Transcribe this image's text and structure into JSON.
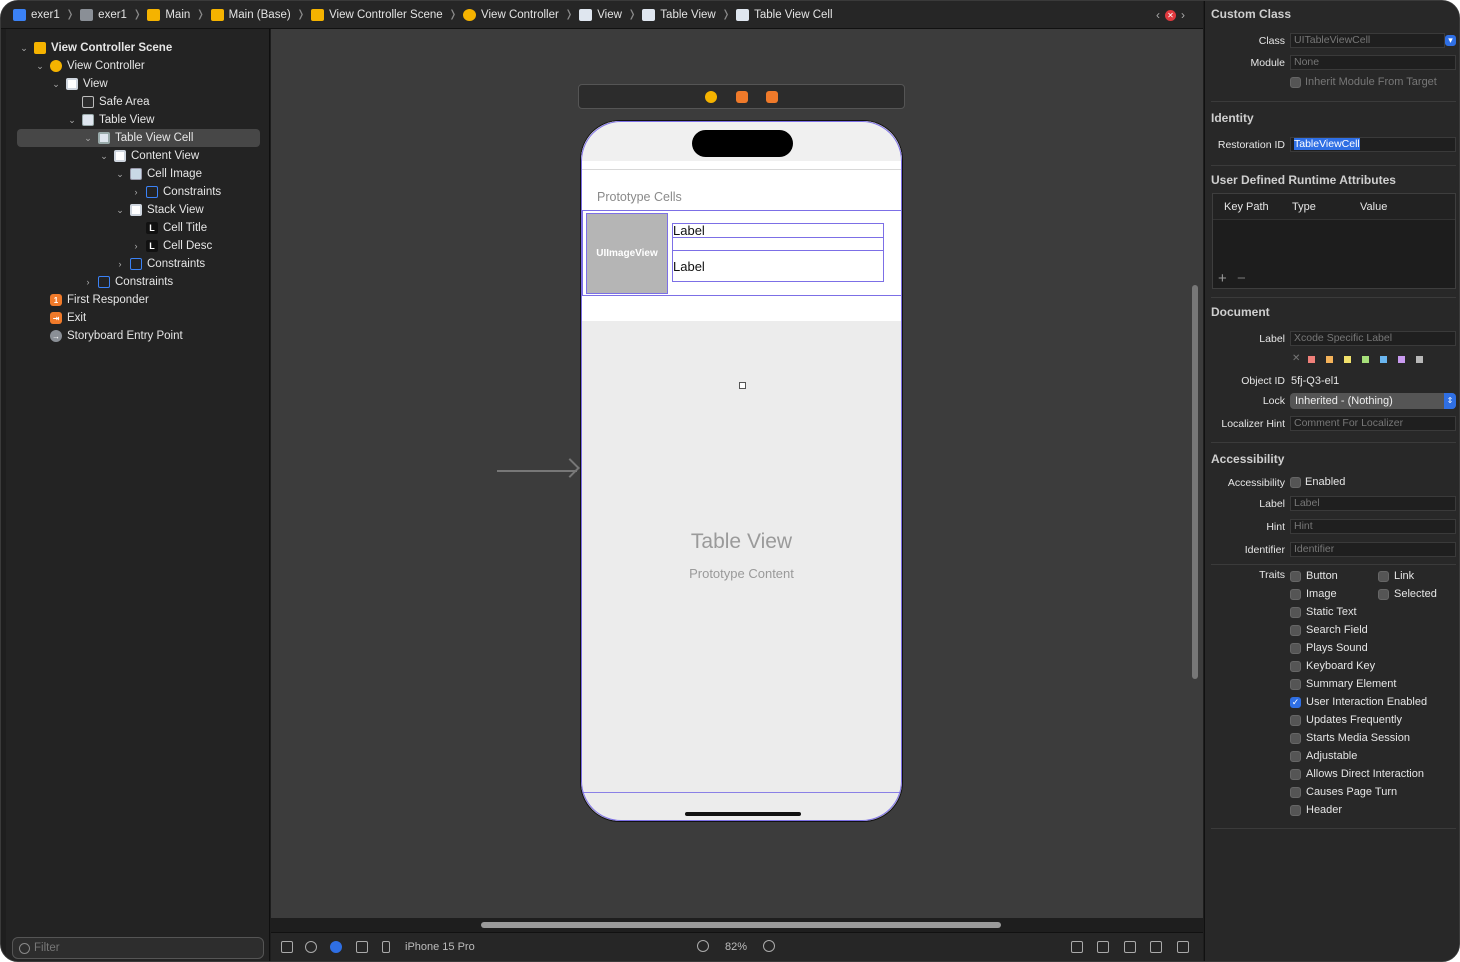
{
  "breadcrumb": [
    {
      "label": "exer1",
      "icon": "project-icon"
    },
    {
      "label": "exer1",
      "icon": "folder-icon"
    },
    {
      "label": "Main",
      "icon": "storyboard-icon"
    },
    {
      "label": "Main (Base)",
      "icon": "storyboard-icon"
    },
    {
      "label": "View Controller Scene",
      "icon": "scene-icon"
    },
    {
      "label": "View Controller",
      "icon": "view-controller-icon"
    },
    {
      "label": "View",
      "icon": "view-icon"
    },
    {
      "label": "Table View",
      "icon": "table-view-icon"
    },
    {
      "label": "Table View Cell",
      "icon": "table-cell-icon"
    }
  ],
  "navigator": {
    "items": [
      {
        "label": "View Controller Scene",
        "indent": 0,
        "chevron": "v",
        "icon": "scene",
        "bold": true
      },
      {
        "label": "View Controller",
        "indent": 1,
        "chevron": "v",
        "icon": "vc"
      },
      {
        "label": "View",
        "indent": 2,
        "chevron": "v",
        "icon": "view"
      },
      {
        "label": "Safe Area",
        "indent": 3,
        "chevron": "",
        "icon": "safe"
      },
      {
        "label": "Table View",
        "indent": 3,
        "chevron": "v",
        "icon": "tbl"
      },
      {
        "label": "Table View Cell",
        "indent": 4,
        "chevron": "v",
        "icon": "cell",
        "selected": true
      },
      {
        "label": "Content View",
        "indent": 5,
        "chevron": "v",
        "icon": "view"
      },
      {
        "label": "Cell Image",
        "indent": 6,
        "chevron": "v",
        "icon": "img"
      },
      {
        "label": "Constraints",
        "indent": 7,
        "chevron": ">",
        "icon": "cons"
      },
      {
        "label": "Stack View",
        "indent": 6,
        "chevron": "v",
        "icon": "view"
      },
      {
        "label": "Cell Title",
        "indent": 7,
        "chevron": "",
        "icon": "lbl"
      },
      {
        "label": "Cell Desc",
        "indent": 7,
        "chevron": ">",
        "icon": "lbl"
      },
      {
        "label": "Constraints",
        "indent": 6,
        "chevron": ">",
        "icon": "cons"
      },
      {
        "label": "Constraints",
        "indent": 4,
        "chevron": ">",
        "icon": "cons"
      },
      {
        "label": "First Responder",
        "indent": 1,
        "chevron": "",
        "icon": "fr"
      },
      {
        "label": "Exit",
        "indent": 1,
        "chevron": "",
        "icon": "exit"
      },
      {
        "label": "Storyboard Entry Point",
        "indent": 1,
        "chevron": "",
        "icon": "entry"
      }
    ],
    "filter_placeholder": "Filter"
  },
  "canvas": {
    "prototype_cells": "Prototype Cells",
    "image_view": "UIImageView",
    "label1": "Label",
    "label2": "Label",
    "table_title": "Table View",
    "table_sub": "Prototype Content"
  },
  "bottom_bar": {
    "device": "iPhone 15 Pro",
    "zoom": "82%"
  },
  "inspector": {
    "custom_class": {
      "header": "Custom Class",
      "class_label": "Class",
      "class_placeholder": "UITableViewCell",
      "module_label": "Module",
      "module_value": "None",
      "inherit": "Inherit Module From Target"
    },
    "identity": {
      "header": "Identity",
      "restoration_label": "Restoration ID",
      "restoration_value": "TableViewCell"
    },
    "runtime": {
      "header": "User Defined Runtime Attributes",
      "columns": [
        "Key Path",
        "Type",
        "Value"
      ]
    },
    "document": {
      "header": "Document",
      "label_label": "Label",
      "label_placeholder": "Xcode Specific Label",
      "swatches": [
        "#f0807a",
        "#f5b35a",
        "#f1e16b",
        "#a6e07a",
        "#6ab6f0",
        "#c99af0",
        "#b8b8b8"
      ],
      "object_id_label": "Object ID",
      "object_id": "5fj-Q3-el1",
      "lock_label": "Lock",
      "lock_value": "Inherited - (Nothing)",
      "hint_label": "Localizer Hint",
      "hint_placeholder": "Comment For Localizer"
    },
    "accessibility": {
      "header": "Accessibility",
      "acc_label": "Accessibility",
      "enabled": "Enabled",
      "label_label": "Label",
      "label_placeholder": "Label",
      "hint_label": "Hint",
      "hint_placeholder": "Hint",
      "identifier_label": "Identifier",
      "identifier_placeholder": "Identifier",
      "traits_label": "Traits",
      "traits_left": [
        {
          "name": "Button",
          "checked": false
        },
        {
          "name": "Image",
          "checked": false
        },
        {
          "name": "Static Text",
          "checked": false
        },
        {
          "name": "Search Field",
          "checked": false
        },
        {
          "name": "Plays Sound",
          "checked": false
        },
        {
          "name": "Keyboard Key",
          "checked": false
        },
        {
          "name": "Summary Element",
          "checked": false
        },
        {
          "name": "User Interaction Enabled",
          "checked": true
        },
        {
          "name": "Updates Frequently",
          "checked": false
        },
        {
          "name": "Starts Media Session",
          "checked": false
        },
        {
          "name": "Adjustable",
          "checked": false
        },
        {
          "name": "Allows Direct Interaction",
          "checked": false
        },
        {
          "name": "Causes Page Turn",
          "checked": false
        },
        {
          "name": "Header",
          "checked": false
        }
      ],
      "traits_right": [
        {
          "name": "Link",
          "checked": false
        },
        {
          "name": "Selected",
          "checked": false
        }
      ]
    }
  }
}
